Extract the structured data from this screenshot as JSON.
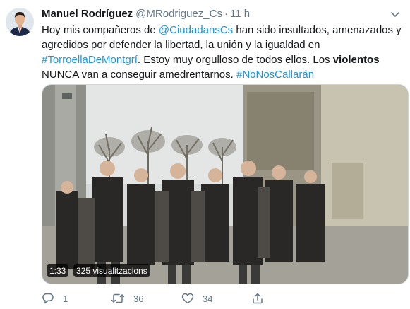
{
  "tweet": {
    "author_name": "Manuel Rodríguez",
    "author_handle": "@MRodriguez_Cs",
    "separator": "·",
    "time": "11 h",
    "text": {
      "part1": "Hoy mis compañeros de ",
      "mention": "@CiudadansCs",
      "part2": " han sido insultados, amenazados y agredidos por defender la libertad, la unión y la igualdad en ",
      "hashtag1": "#TorroellaDeMontgrí",
      "part3": ". Estoy muy orgulloso de todos ellos. Los ",
      "bold_word": "violentos",
      "part4": " NUNCA van a conseguir amedrentarnos. ",
      "hashtag2": "#NoNosCallarán"
    },
    "video": {
      "duration": "1:33",
      "views": "325 visualitzacions"
    },
    "actions": {
      "reply_count": "1",
      "retweet_count": "36",
      "like_count": "34"
    }
  },
  "colors": {
    "link": "#1b95e0",
    "muted": "#657786",
    "text": "#14171a"
  },
  "icons": [
    "chevron-down-icon",
    "reply-icon",
    "retweet-icon",
    "like-icon",
    "share-icon"
  ]
}
